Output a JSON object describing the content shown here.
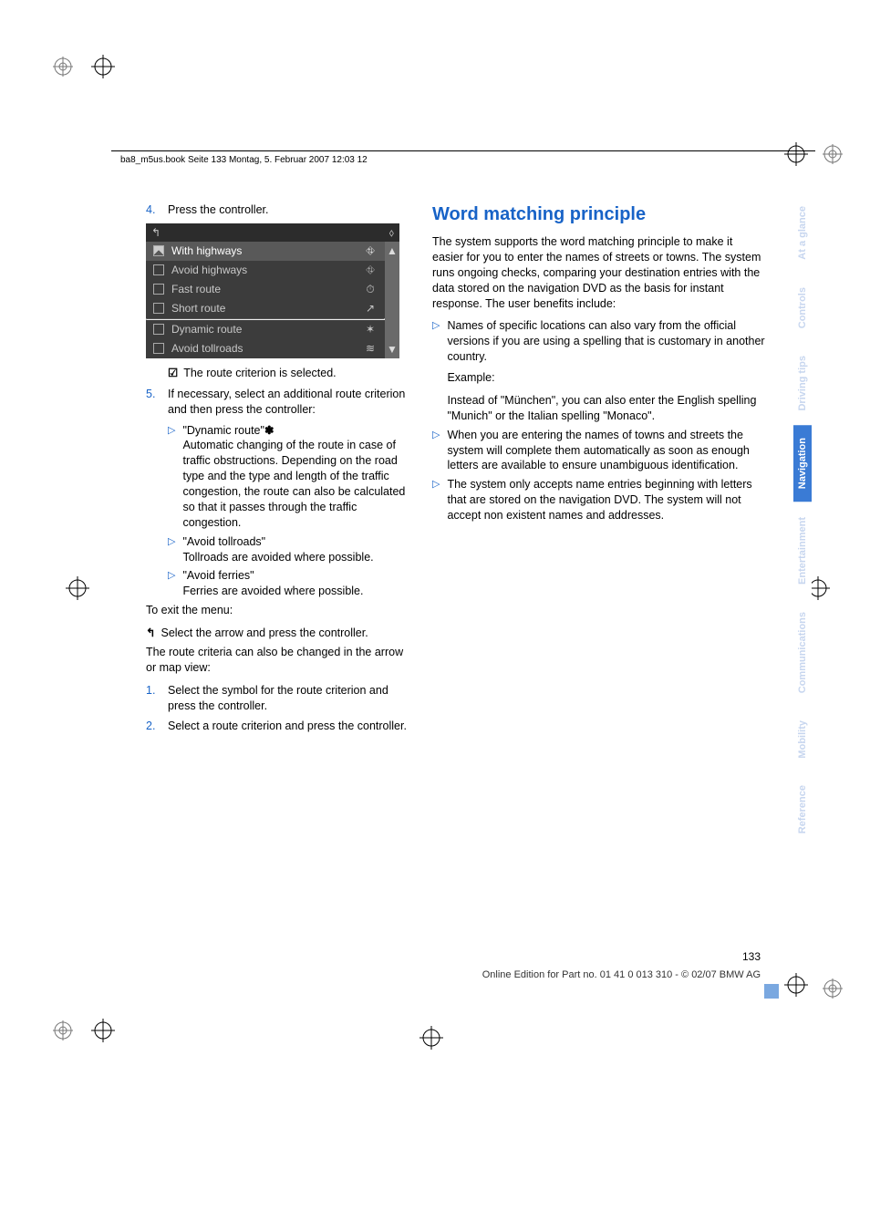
{
  "header": {
    "file_info": "ba8_m5us.book  Seite 133  Montag, 5. Februar 2007  12:03 12"
  },
  "left_column": {
    "step4": {
      "num": "4.",
      "text": "Press the controller."
    },
    "screenshot": {
      "back_icon": "↰",
      "top_right_icon": "⬨",
      "rows": [
        {
          "checked": true,
          "label": "With highways",
          "icon": "⛗",
          "selected": true
        },
        {
          "checked": false,
          "label": "Avoid highways",
          "icon": "⛗",
          "selected": false
        },
        {
          "checked": false,
          "label": "Fast route",
          "icon": "⏱",
          "selected": false
        },
        {
          "checked": false,
          "label": "Short route",
          "icon": "↗",
          "selected": false
        },
        {
          "checked": false,
          "label": "Dynamic route",
          "icon": "✶",
          "selected": false
        },
        {
          "checked": false,
          "label": "Avoid tollroads",
          "icon": "≋",
          "selected": false
        }
      ],
      "scroll_up": "▲",
      "scroll_down": "▼"
    },
    "selected_line": {
      "icon": "☑",
      "text": " The route criterion is selected."
    },
    "step5": {
      "num": "5.",
      "text": "If necessary, select an additional route criterion and then press the controller:"
    },
    "step5_items": [
      {
        "title": "\"Dynamic route\"",
        "star": "✽",
        "body": "Automatic changing of the route in case of traffic obstructions. Depending on the road type and the type and length of the traffic congestion, the route can also be calculated so that it passes through the traffic congestion."
      },
      {
        "title": "\"Avoid tollroads\"",
        "star": "",
        "body": "Tollroads are avoided where possible."
      },
      {
        "title": "\"Avoid ferries\"",
        "star": "",
        "body": "Ferries are avoided where possible."
      }
    ],
    "exit_label": "To exit the menu:",
    "exit_icon": "↰",
    "exit_text": " Select the arrow and press the controller.",
    "route_criteria_note": "The route criteria can also be changed in the arrow or map view:",
    "steps_view": [
      {
        "num": "1.",
        "text": "Select the symbol for the route criterion and press the controller."
      },
      {
        "num": "2.",
        "text": "Select a route criterion and press the controller."
      }
    ]
  },
  "right_column": {
    "heading": "Word matching principle",
    "intro": "The system supports the word matching principle to make it easier for you to enter the names of streets or towns. The system runs ongoing checks, comparing your destination entries with the data stored on the navigation DVD as the basis for instant response. The user benefits include:",
    "bullets": [
      {
        "lead": "Names of specific locations can also vary from the official versions if you are using a spelling that is customary in another country.",
        "extra": [
          "Example:",
          "Instead of \"München\", you can also enter the English spelling \"Munich\" or the Italian spelling \"Monaco\"."
        ]
      },
      {
        "lead": "When you are entering the names of towns and streets the system will complete them automatically as soon as enough letters are available to ensure unambiguous identification.",
        "extra": []
      },
      {
        "lead": "The system only accepts name entries beginning with letters that are stored on the navigation DVD. The system will not accept non existent names and addresses.",
        "extra": []
      }
    ]
  },
  "side_tabs": [
    {
      "label": "At a glance",
      "active": false
    },
    {
      "label": "Controls",
      "active": false
    },
    {
      "label": "Driving tips",
      "active": false
    },
    {
      "label": "Navigation",
      "active": true
    },
    {
      "label": "Entertainment",
      "active": false
    },
    {
      "label": "Communications",
      "active": false
    },
    {
      "label": "Mobility",
      "active": false
    },
    {
      "label": "Reference",
      "active": false
    }
  ],
  "footer": {
    "page_number": "133",
    "edition": "Online Edition for Part no. 01 41 0 013 310 - © 02/07 BMW AG"
  },
  "triangle": "▷"
}
